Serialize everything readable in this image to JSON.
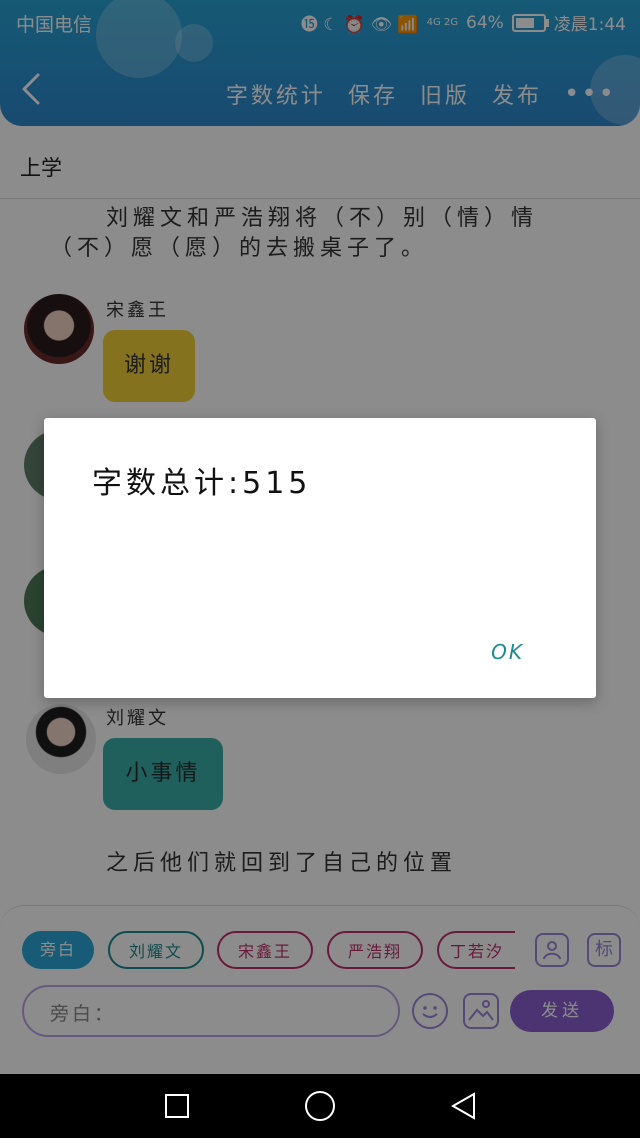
{
  "status_bar": {
    "carrier": "中国电信",
    "icons_text": "⓯ ☾ ⏰ 👁 📶",
    "network": "4G 2G",
    "battery": "64%",
    "time": "凌晨1:44"
  },
  "toolbar": {
    "word_count_label": "字数统计",
    "save_label": "保存",
    "old_version_label": "旧版",
    "publish_label": "发布",
    "more_label": "•••"
  },
  "section_title": "上学",
  "narration_top": {
    "line1": "刘耀文和严浩翔将（不）别（情）情",
    "line2": "（不）愿（愿）的去搬桌子了。"
  },
  "messages": [
    {
      "name": "宋鑫王",
      "text": "谢谢"
    },
    {
      "name": "刘耀文",
      "text": "小事情"
    }
  ],
  "narration_bottom": "之后他们就回到了自己的位置",
  "chips": [
    "旁白",
    "刘耀文",
    "宋鑫王",
    "严浩翔",
    "丁若汐"
  ],
  "side_icons": {
    "role_icon": "",
    "tag_label": "标"
  },
  "input": {
    "placeholder": "旁白："
  },
  "send_label": "发送",
  "dialog": {
    "message": "字数总计:515",
    "ok_label": "OK"
  },
  "colors": {
    "header": "#2b8fd0",
    "accent_purple": "#8a5fcf",
    "ok_teal": "#1b8b8f",
    "bubble_yellow": "#f0cf3a",
    "bubble_teal": "#3ab0a8"
  }
}
